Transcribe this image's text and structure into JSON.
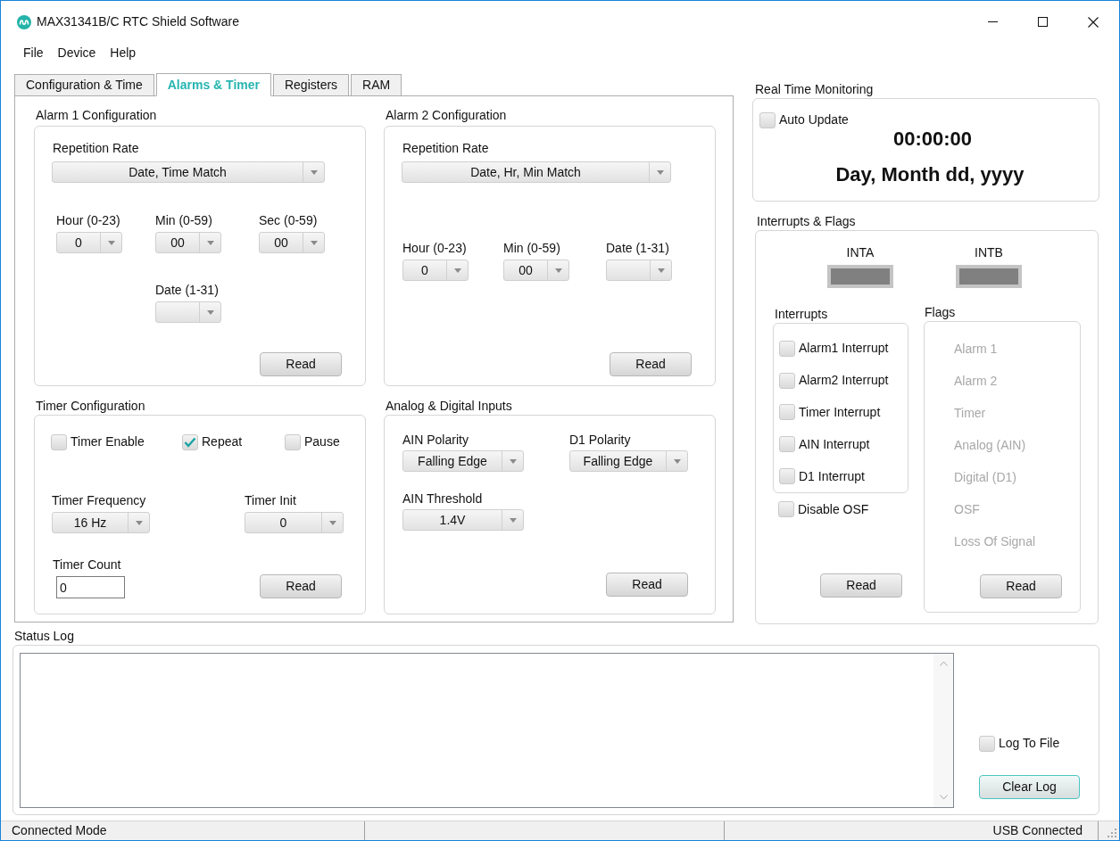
{
  "window": {
    "title": "MAX31341B/C RTC Shield Software"
  },
  "menu": [
    {
      "label": "File"
    },
    {
      "label": "Device"
    },
    {
      "label": "Help"
    }
  ],
  "tabs": [
    {
      "label": "Configuration & Time",
      "selected": false
    },
    {
      "label": "Alarms & Timer",
      "selected": true
    },
    {
      "label": "Registers",
      "selected": false
    },
    {
      "label": "RAM",
      "selected": false
    }
  ],
  "alarm1": {
    "title": "Alarm 1 Configuration",
    "repetition": {
      "label": "Repetition Rate",
      "value": "Date, Time Match"
    },
    "fields": [
      {
        "label": "Hour (0-23)",
        "value": "0"
      },
      {
        "label": "Min (0-59)",
        "value": "00"
      },
      {
        "label": "Sec (0-59)",
        "value": "00"
      },
      {
        "label": "Date (1-31)"
      }
    ],
    "read_button": "Read"
  },
  "alarm2": {
    "title": "Alarm 2 Configuration",
    "repetition": {
      "label": "Repetition Rate",
      "value": "Date, Hr, Min Match"
    },
    "fields": [
      {
        "label": "Hour (0-23)",
        "value": "0"
      },
      {
        "label": "Min (0-59)",
        "value": "00"
      },
      {
        "label": "Date (1-31)"
      }
    ],
    "read_button": "Read"
  },
  "timer": {
    "title": "Timer Configuration",
    "options": [
      {
        "label": "Timer Enable",
        "checked": false
      },
      {
        "label": "Repeat",
        "checked": true
      },
      {
        "label": "Pause",
        "checked": false
      }
    ],
    "frequency": {
      "label": "Timer Frequency",
      "value": "16 Hz"
    },
    "init": {
      "label": "Timer Init",
      "value": "0"
    },
    "count": {
      "label": "Timer Count",
      "value": "0"
    },
    "read_button": "Read"
  },
  "inputs": {
    "title": "Analog & Digital Inputs",
    "ain_polarity": {
      "label": "AIN Polarity",
      "value": "Falling Edge"
    },
    "d1_polarity": {
      "label": "D1 Polarity",
      "value": "Falling Edge"
    },
    "ain_threshold": {
      "label": "AIN Threshold",
      "value": "1.4V"
    },
    "read_button": "Read"
  },
  "monitoring": {
    "title": "Real Time Monitoring",
    "auto_update": {
      "label": "Auto Update",
      "checked": false
    },
    "time": "00:00:00",
    "date": "Day, Month dd, yyyy"
  },
  "interrupts_flags": {
    "title": "Interrupts & Flags",
    "indicators": [
      {
        "label": "INTA"
      },
      {
        "label": "INTB"
      }
    ],
    "interrupts": {
      "title": "Interrupts",
      "items": [
        {
          "label": "Alarm1 Interrupt",
          "checked": false
        },
        {
          "label": "Alarm2 Interrupt",
          "checked": false
        },
        {
          "label": "Timer Interrupt",
          "checked": false
        },
        {
          "label": "AIN Interrupt",
          "checked": false
        },
        {
          "label": "D1 Interrupt",
          "checked": false
        }
      ],
      "read_button": "Read"
    },
    "disable_osf": {
      "label": "Disable OSF",
      "checked": false
    },
    "flags": {
      "title": "Flags",
      "items": [
        {
          "label": "Alarm 1",
          "disabled": true
        },
        {
          "label": "Alarm 2",
          "disabled": true
        },
        {
          "label": "Timer",
          "disabled": true
        },
        {
          "label": "Analog (AIN)",
          "disabled": true
        },
        {
          "label": "Digital (D1)",
          "disabled": true
        },
        {
          "label": "OSF",
          "disabled": true
        },
        {
          "label": "Loss Of Signal",
          "disabled": true
        }
      ],
      "read_button": "Read"
    }
  },
  "status_log": {
    "title": "Status Log",
    "log_to_file": {
      "label": "Log To File",
      "checked": false
    },
    "clear_button": "Clear Log"
  },
  "status_bar": {
    "left": "Connected Mode",
    "right": "USB Connected"
  }
}
